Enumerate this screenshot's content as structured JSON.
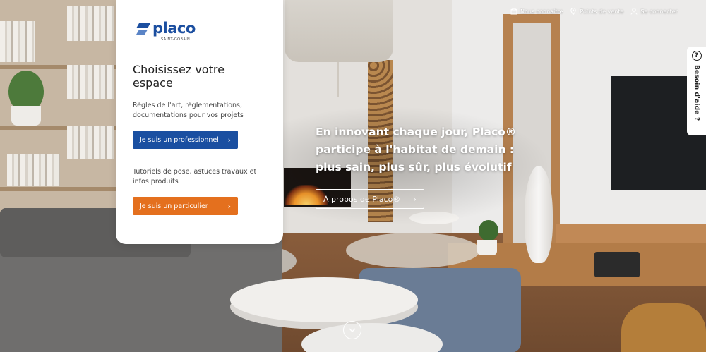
{
  "brand": {
    "name": "placo",
    "subtitle": "SAINT-GOBAIN",
    "color": "#1c4fa0"
  },
  "toplinks": [
    {
      "label": "Nous connaître",
      "icon": "building-icon"
    },
    {
      "label": "Points de vente",
      "icon": "location-pin-icon"
    },
    {
      "label": "Se connecter",
      "icon": "user-icon"
    }
  ],
  "help": {
    "icon": "?",
    "label": "Besoin d'aide ?"
  },
  "card": {
    "title": "Choisissez votre espace",
    "pro_desc": "Règles de l'art, réglementations, documentations pour vos projets",
    "pro_button": "Je suis un professionnel",
    "part_desc": "Tutoriels de pose, astuces travaux et infos produits",
    "part_button": "Je suis un particulier",
    "pro_color": "#1a4fa1",
    "part_color": "#e4701e"
  },
  "hero": {
    "text": "En innovant chaque jour, Placo® participe à l'habitat de demain : plus sain, plus sûr, plus évolutif",
    "button": "À propos de Placo®"
  }
}
